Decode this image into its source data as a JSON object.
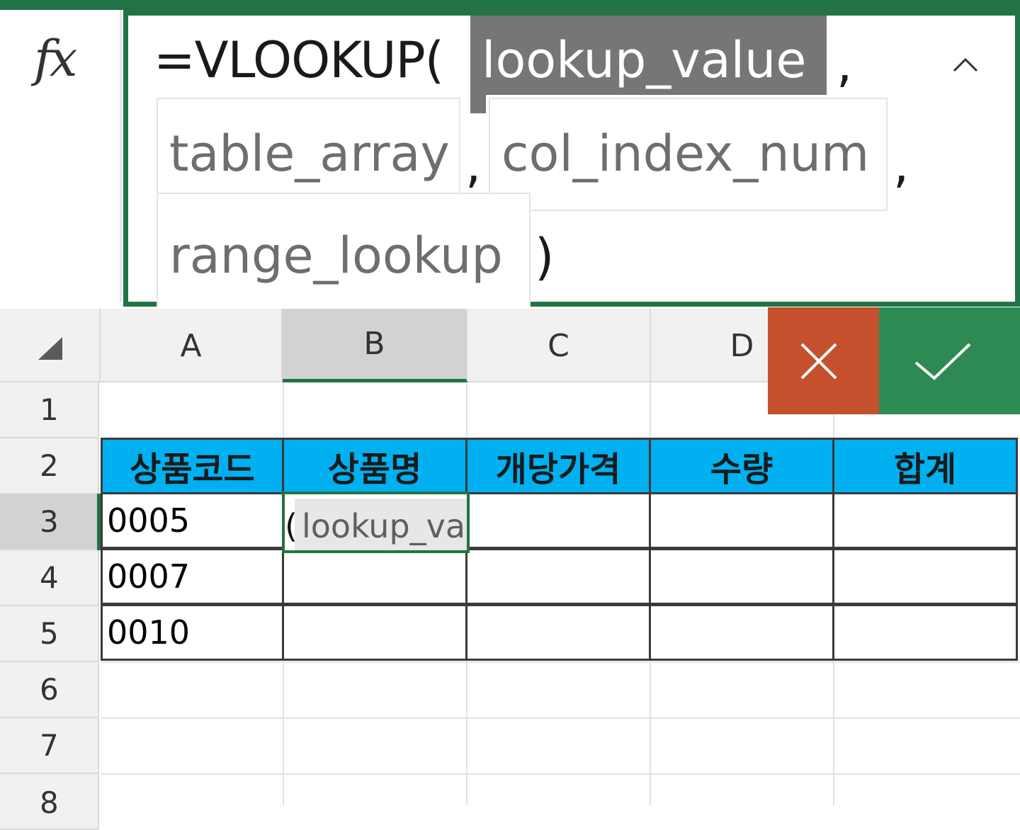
{
  "formula_bar": {
    "fx_label": "fx",
    "prefix": "=VLOOKUP(",
    "args": [
      "lookup_value",
      "table_array",
      "col_index_num",
      "range_lookup"
    ],
    "separator": ",",
    "close": ")",
    "active_arg_index": 0
  },
  "columns": [
    "A",
    "B",
    "C",
    "D"
  ],
  "selected_column": "B",
  "rows": [
    "1",
    "2",
    "3",
    "4",
    "5",
    "6",
    "7",
    "8"
  ],
  "selected_row": "3",
  "table": {
    "headers": [
      "상품코드",
      "상품명",
      "개당가격",
      "수량",
      "합계"
    ],
    "codes": [
      "0005",
      "0007",
      "0010"
    ]
  },
  "active_cell": {
    "address": "B3",
    "prefix": "(",
    "hint": "lookup_value"
  },
  "buttons": {
    "cancel": "cancel",
    "enter": "enter"
  },
  "colors": {
    "accent": "#217346",
    "cancel": "#c4502d",
    "enter": "#2d8a52",
    "table_header": "#00b0f0",
    "active_arg_bg": "#767676"
  }
}
